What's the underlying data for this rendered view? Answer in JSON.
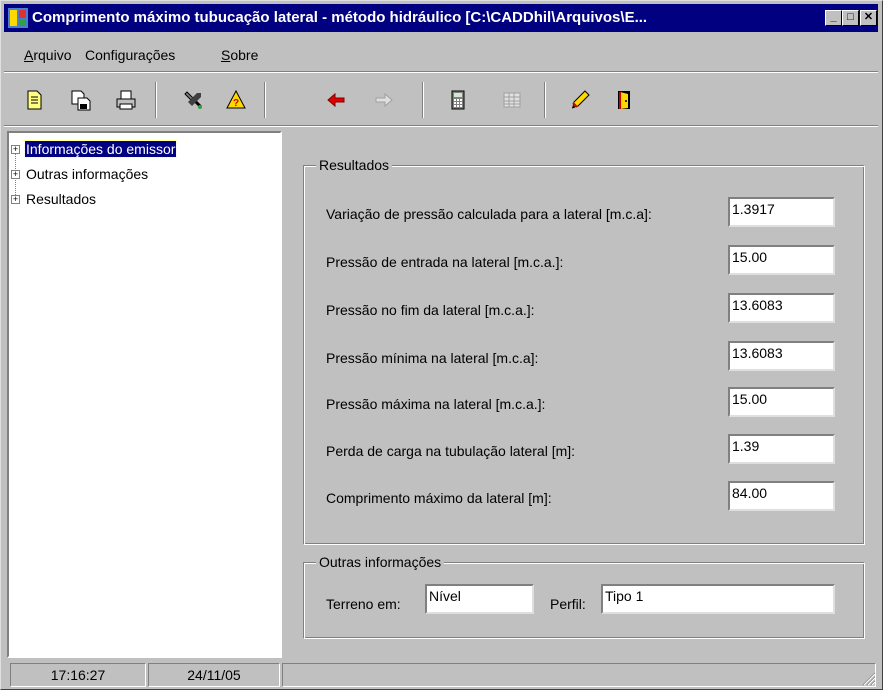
{
  "window": {
    "title": "Comprimento máximo tubucação lateral - método hidráulico [C:\\CADDhil\\Arquivos\\E...",
    "minimize_glyph": "_",
    "maximize_glyph": "□",
    "close_glyph": "✕"
  },
  "menu": {
    "arquivo_prefix": "A",
    "arquivo_rest": "rquivo",
    "configuracoes": "Configurações",
    "sobre_prefix": "S",
    "sobre_rest": "obre"
  },
  "toolbar": {
    "icons": [
      "new-document-icon",
      "save-icon",
      "print-icon",
      "tools-icon",
      "help-icon",
      "back-arrow-icon",
      "forward-arrow-icon",
      "calculator-icon",
      "table-icon",
      "pencil-icon",
      "exit-door-icon"
    ]
  },
  "tree": {
    "expander_glyph": "+",
    "items": [
      {
        "label": "Informações do emissor",
        "selected": true
      },
      {
        "label": "Outras informações",
        "selected": false
      },
      {
        "label": "Resultados",
        "selected": false
      }
    ]
  },
  "resultados": {
    "legend": "Resultados",
    "rows": [
      {
        "label": "Variação de pressão calculada para a lateral [m.c.a]:",
        "value": "1.3917"
      },
      {
        "label": "Pressão de entrada na lateral [m.c.a.]:",
        "value": "15.00"
      },
      {
        "label": "Pressão no fim da lateral [m.c.a.]:",
        "value": "13.6083"
      },
      {
        "label": "Pressão mínima na lateral [m.c.a]:",
        "value": "13.6083"
      },
      {
        "label": "Pressão máxima na lateral [m.c.a.]:",
        "value": "15.00"
      },
      {
        "label": "Perda de carga na tubulação lateral [m]:",
        "value": "1.39"
      },
      {
        "label": "Comprimento máximo da lateral [m]:",
        "value": "84.00"
      }
    ]
  },
  "outras": {
    "legend": "Outras informações",
    "terreno_label": "Terreno em:",
    "terreno_value": "Nível",
    "perfil_label": "Perfil:",
    "perfil_value": "Tipo 1"
  },
  "status": {
    "time": "17:16:27",
    "date": "24/11/05"
  }
}
